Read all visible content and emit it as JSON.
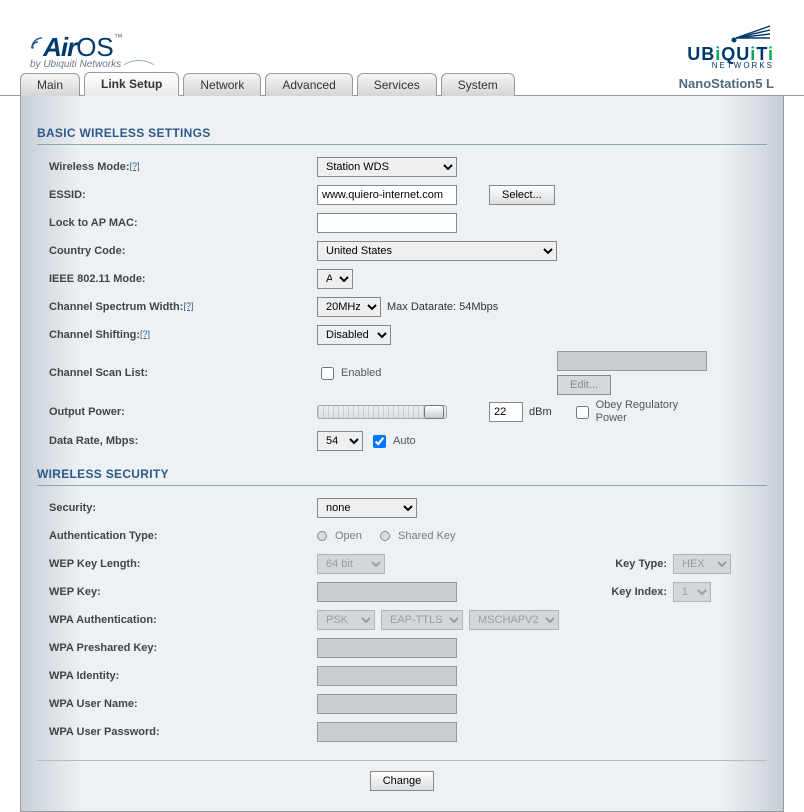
{
  "logo": {
    "brand_air": "Air",
    "brand_os": "OS",
    "tm": "™",
    "byline": "by Ubiquiti Networks"
  },
  "logo_right": {
    "ubnt": "UBIQUITI",
    "net": "NETWORKS"
  },
  "tabs": [
    {
      "label": "Main"
    },
    {
      "label": "Link Setup"
    },
    {
      "label": "Network"
    },
    {
      "label": "Advanced"
    },
    {
      "label": "Services"
    },
    {
      "label": "System"
    }
  ],
  "device_name": "NanoStation5 L",
  "basic": {
    "title": "BASIC WIRELESS SETTINGS",
    "wireless_mode": {
      "label": "Wireless Mode:",
      "value": "Station WDS",
      "help": "[?]"
    },
    "essid": {
      "label": "ESSID:",
      "value": "www.quiero-internet.com",
      "select_btn": "Select..."
    },
    "lock_mac": {
      "label": "Lock to AP MAC:",
      "value": ""
    },
    "country": {
      "label": "Country Code:",
      "value": "United States"
    },
    "ieee_mode": {
      "label": "IEEE 802.11 Mode:",
      "value": "A"
    },
    "spectrum": {
      "label": "Channel Spectrum Width:",
      "value": "20MHz",
      "help": "[?]",
      "note": "Max Datarate: 54Mbps"
    },
    "shifting": {
      "label": "Channel Shifting:",
      "value": "Disabled",
      "help": "[?]"
    },
    "scanlist": {
      "label": "Channel Scan List:",
      "enabled_label": "Enabled",
      "edit_btn": "Edit...",
      "value": ""
    },
    "output_power": {
      "label": "Output Power:",
      "value": "22",
      "unit": "dBm",
      "obey_label": "Obey Regulatory Power"
    },
    "data_rate": {
      "label": "Data Rate, Mbps:",
      "value": "54",
      "auto_label": "Auto"
    }
  },
  "security": {
    "title": "WIRELESS SECURITY",
    "security": {
      "label": "Security:",
      "value": "none"
    },
    "auth_type": {
      "label": "Authentication Type:",
      "open": "Open",
      "shared": "Shared Key"
    },
    "wep_len": {
      "label": "WEP Key Length:",
      "value": "64 bit",
      "key_type_label": "Key Type:",
      "key_type_value": "HEX"
    },
    "wep_key": {
      "label": "WEP Key:",
      "value": "",
      "key_index_label": "Key Index:",
      "key_index_value": "1"
    },
    "wpa_auth": {
      "label": "WPA Authentication:",
      "v1": "PSK",
      "v2": "EAP-TTLS",
      "v3": "MSCHAPV2"
    },
    "wpa_psk": {
      "label": "WPA Preshared Key:",
      "value": ""
    },
    "wpa_identity": {
      "label": "WPA Identity:",
      "value": ""
    },
    "wpa_user": {
      "label": "WPA User Name:",
      "value": ""
    },
    "wpa_pass": {
      "label": "WPA User Password:",
      "value": ""
    }
  },
  "submit": {
    "change": "Change"
  }
}
